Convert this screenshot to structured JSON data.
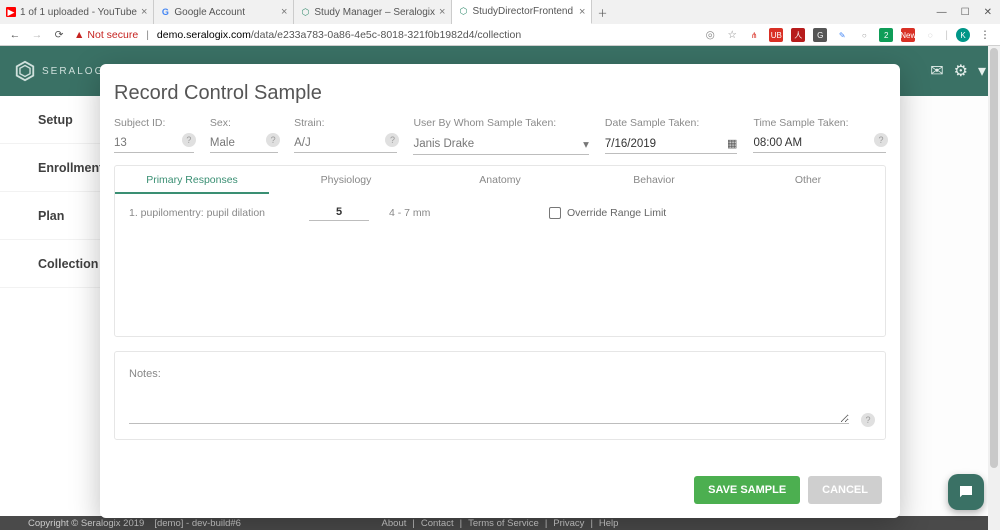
{
  "browser": {
    "tabs": [
      {
        "label": "1 of 1 uploaded - YouTube",
        "favicon": "▶",
        "fav_bg": "#ff0000"
      },
      {
        "label": "Google Account",
        "favicon": "G",
        "fav_bg": "#ffffff"
      },
      {
        "label": "Study Manager – Seralogix",
        "favicon": "◆",
        "fav_bg": "#ffffff"
      },
      {
        "label": "StudyDirectorFrontend",
        "favicon": "◆",
        "fav_bg": "#ffffff"
      }
    ],
    "not_secure": "Not secure",
    "url_host": "demo.seralogix.com",
    "url_path": "/data/e233a783-0a86-4e5c-8018-321f0b1982d4/collection",
    "avatar_letter": "K"
  },
  "app": {
    "brand": "SERALOGIX",
    "sidebar": [
      "Setup",
      "Enrollment",
      "Plan",
      "Collection"
    ]
  },
  "footer": {
    "copyright": "Copyright © Seralogix 2019",
    "build": "[demo] - dev-build#6",
    "links": [
      "About",
      "Contact",
      "Terms of Service",
      "Privacy",
      "Help"
    ]
  },
  "modal": {
    "title": "Record Control Sample",
    "fields": {
      "subject_id": {
        "label": "Subject ID:",
        "value": "13"
      },
      "sex": {
        "label": "Sex:",
        "value": "Male"
      },
      "strain": {
        "label": "Strain:",
        "value": "A/J"
      },
      "user": {
        "label": "User By Whom Sample Taken:",
        "value": "Janis Drake"
      },
      "date": {
        "label": "Date Sample Taken:",
        "value": "7/16/2019"
      },
      "time": {
        "label": "Time Sample Taken:",
        "value": "08:00 AM"
      }
    },
    "tabs": [
      "Primary Responses",
      "Physiology",
      "Anatomy",
      "Behavior",
      "Other"
    ],
    "active_tab": 0,
    "response_row": {
      "label": "1. pupilomentry: pupil dilation",
      "value": "5",
      "range": "4 - 7 mm",
      "override": "Override Range Limit"
    },
    "notes_label": "Notes:",
    "save": "SAVE SAMPLE",
    "cancel": "CANCEL"
  }
}
